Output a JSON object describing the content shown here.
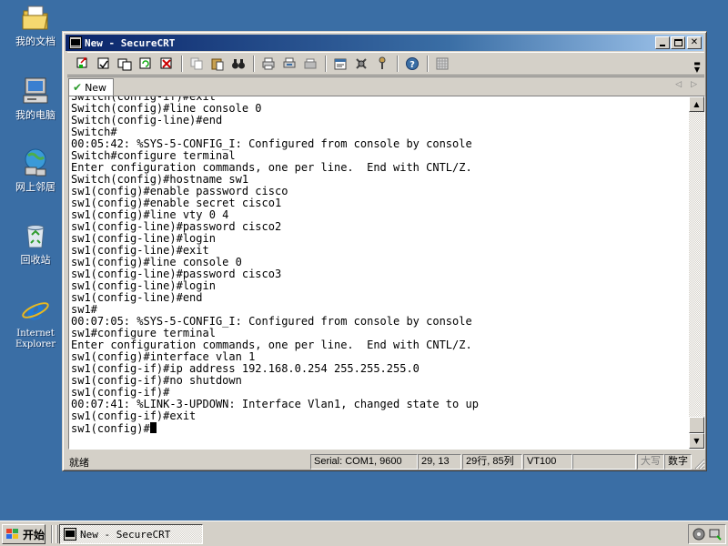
{
  "desktop": {
    "icons": [
      {
        "label": "我的文档",
        "icon": "my-documents-icon"
      },
      {
        "label": "我的电脑",
        "icon": "my-computer-icon"
      },
      {
        "label": "网上邻居",
        "icon": "network-places-icon"
      },
      {
        "label": "回收站",
        "icon": "recycle-bin-icon"
      },
      {
        "label": "Internet Explorer",
        "line1": "Internet",
        "line2": "Explorer",
        "icon": "internet-explorer-icon"
      }
    ]
  },
  "window": {
    "title": "New - SecureCRT",
    "tab": {
      "label": "New"
    }
  },
  "terminal": {
    "lines": [
      "Switch(config-if)#exit",
      "Switch(config)#line console 0",
      "Switch(config-line)#end",
      "Switch#",
      "00:05:42: %SYS-5-CONFIG_I: Configured from console by console",
      "Switch#configure terminal",
      "Enter configuration commands, one per line.  End with CNTL/Z.",
      "Switch(config)#hostname sw1",
      "sw1(config)#enable password cisco",
      "sw1(config)#enable secret cisco1",
      "sw1(config)#line vty 0 4",
      "sw1(config-line)#password cisco2",
      "sw1(config-line)#login",
      "sw1(config-line)#exit",
      "sw1(config)#line console 0",
      "sw1(config-line)#password cisco3",
      "sw1(config-line)#login",
      "sw1(config-line)#end",
      "sw1#",
      "00:07:05: %SYS-5-CONFIG_I: Configured from console by console",
      "sw1#configure terminal",
      "Enter configuration commands, one per line.  End with CNTL/Z.",
      "sw1(config)#interface vlan 1",
      "sw1(config-if)#ip address 192.168.0.254 255.255.255.0",
      "sw1(config-if)#no shutdown",
      "sw1(config-if)#",
      "00:07:41: %LINK-3-UPDOWN: Interface Vlan1, changed state to up",
      "sw1(config-if)#exit"
    ],
    "prompt": "sw1(config)#"
  },
  "statusbar": {
    "ready": "就绪",
    "connection": "Serial: COM1, 9600",
    "cursor_pos": "29, 13",
    "rows_cols": "29行, 85列",
    "emulation": "VT100",
    "caps": "大写",
    "num": "数字"
  },
  "taskbar": {
    "start": "开始",
    "task": "New - SecureCRT"
  }
}
